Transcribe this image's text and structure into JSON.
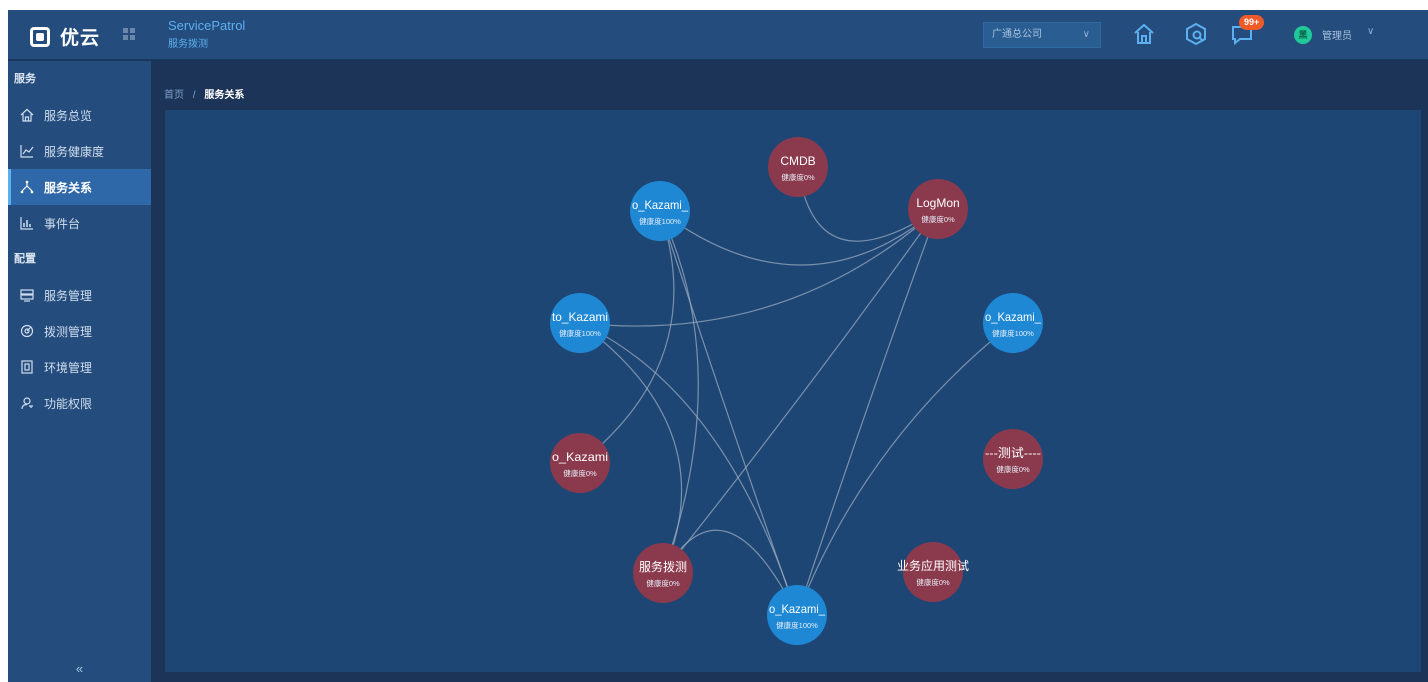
{
  "brand": {
    "logo_text": "优云"
  },
  "app": {
    "title": "ServicePatrol",
    "subtitle": "服务拨测"
  },
  "header": {
    "company_select": {
      "value": "广通总公司"
    },
    "notification_badge": "99+",
    "user": {
      "avatar_text": "黑",
      "name": "管理员"
    },
    "icons": [
      "home-icon",
      "box-search-icon",
      "message-icon",
      "chevron-down-icon"
    ]
  },
  "sidebar": {
    "groups": [
      {
        "label": "服务"
      },
      {
        "label": "配置"
      }
    ],
    "items": [
      {
        "label": "服务总览",
        "icon": "home-outline-icon"
      },
      {
        "label": "服务健康度",
        "icon": "line-chart-icon"
      },
      {
        "label": "服务关系",
        "icon": "relation-icon",
        "active": true
      },
      {
        "label": "事件台",
        "icon": "bar-chart-icon"
      },
      {
        "label": "服务管理",
        "icon": "server-icon"
      },
      {
        "label": "拨测管理",
        "icon": "probe-icon"
      },
      {
        "label": "环境管理",
        "icon": "environment-icon"
      },
      {
        "label": "功能权限",
        "icon": "user-key-icon"
      }
    ],
    "collapse_label": "«"
  },
  "breadcrumb": {
    "home": "首页",
    "separator": "/",
    "current": "服务关系"
  },
  "colors": {
    "healthy": "#1e88d4",
    "unhealthy": "#8b3a4d",
    "edge": "#9aa9bc"
  },
  "graph": {
    "nodes": [
      {
        "id": "cmdb",
        "label": "CMDB",
        "health": "健康度0%",
        "status": "unhealthy"
      },
      {
        "id": "logmon",
        "label": "LogMon",
        "health": "健康度0%",
        "status": "unhealthy"
      },
      {
        "id": "kz_r",
        "label": "o_Kazami_",
        "health": "健康度100%",
        "status": "healthy"
      },
      {
        "id": "test",
        "label": "---测试----",
        "health": "健康度0%",
        "status": "unhealthy"
      },
      {
        "id": "bizapp",
        "label": "业务应用测试",
        "health": "健康度0%",
        "status": "unhealthy"
      },
      {
        "id": "kz_b",
        "label": "o_Kazami_",
        "health": "健康度100%",
        "status": "healthy"
      },
      {
        "id": "boce",
        "label": "服务拨测",
        "health": "健康度0%",
        "status": "unhealthy"
      },
      {
        "id": "kz_lr",
        "label": "o_Kazami",
        "health": "健康度0%",
        "status": "unhealthy"
      },
      {
        "id": "kz_l",
        "label": "to_Kazami",
        "health": "健康度100%",
        "status": "healthy"
      },
      {
        "id": "kz_t",
        "label": "o_Kazami_",
        "health": "健康度100%",
        "status": "healthy"
      }
    ],
    "edges": [
      [
        "cmdb",
        "logmon"
      ],
      [
        "kz_t",
        "logmon"
      ],
      [
        "kz_l",
        "logmon"
      ],
      [
        "boce",
        "logmon"
      ],
      [
        "kz_b",
        "logmon"
      ],
      [
        "kz_lr",
        "kz_t"
      ],
      [
        "kz_t",
        "kz_b"
      ],
      [
        "kz_t",
        "boce"
      ],
      [
        "kz_l",
        "boce"
      ],
      [
        "kz_l",
        "kz_b"
      ],
      [
        "boce",
        "kz_b"
      ],
      [
        "kz_r",
        "kz_b"
      ]
    ]
  }
}
